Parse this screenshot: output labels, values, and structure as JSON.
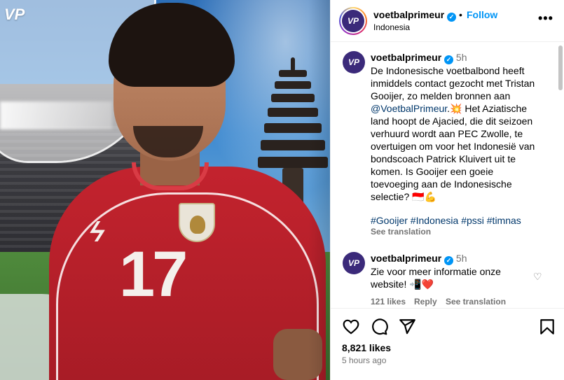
{
  "post": {
    "watermark": "VP",
    "jersey_number": "17"
  },
  "header": {
    "username": "voetbalprimeur",
    "verified_mark": "✓",
    "separator": "•",
    "follow_label": "Follow",
    "location": "Indonesia",
    "more_icon": "•••",
    "avatar_text": "VP"
  },
  "caption": {
    "username": "voetbalprimeur",
    "time": "5h",
    "avatar_text": "VP",
    "line1": "De Indonesische voetbalbond heeft",
    "line2": "inmiddels contact gezocht met Tristan",
    "line3": "Gooijer, zo melden bronnen aan",
    "mention": "@VoetbalPrimeur",
    "line4_rest": ".💥 Het Aziatische",
    "line5": "land hoopt de Ajacied, die dit seizoen",
    "line6": "verhuurd wordt aan PEC Zwolle, te",
    "line7": "overtuigen om voor het Indonesië van",
    "line8": "bondscoach Patrick Kluivert uit te",
    "line9": "komen. Is Gooijer een goeie",
    "line10": "toevoeging aan de Indonesische",
    "line11": "selectie? 🇮🇩💪",
    "hashtags": "#Gooijer #Indonesia #pssi #timnas",
    "see_translation": "See translation"
  },
  "comment": {
    "username": "voetbalprimeur",
    "time": "5h",
    "avatar_text": "VP",
    "line1": "Zie voor meer informatie onze",
    "line2": "website! 📲❤️",
    "likes": "121 likes",
    "reply": "Reply",
    "see_translation": "See translation",
    "like_icon": "♡"
  },
  "footer": {
    "likes": "8,821 likes",
    "posted": "5 hours ago"
  },
  "icons": {
    "like": "heart-icon",
    "comment": "comment-icon",
    "share": "share-icon",
    "save": "bookmark-icon"
  },
  "colors": {
    "accent": "#0095f6",
    "link": "#00376b",
    "muted": "#737373",
    "jersey": "#c3232e"
  }
}
